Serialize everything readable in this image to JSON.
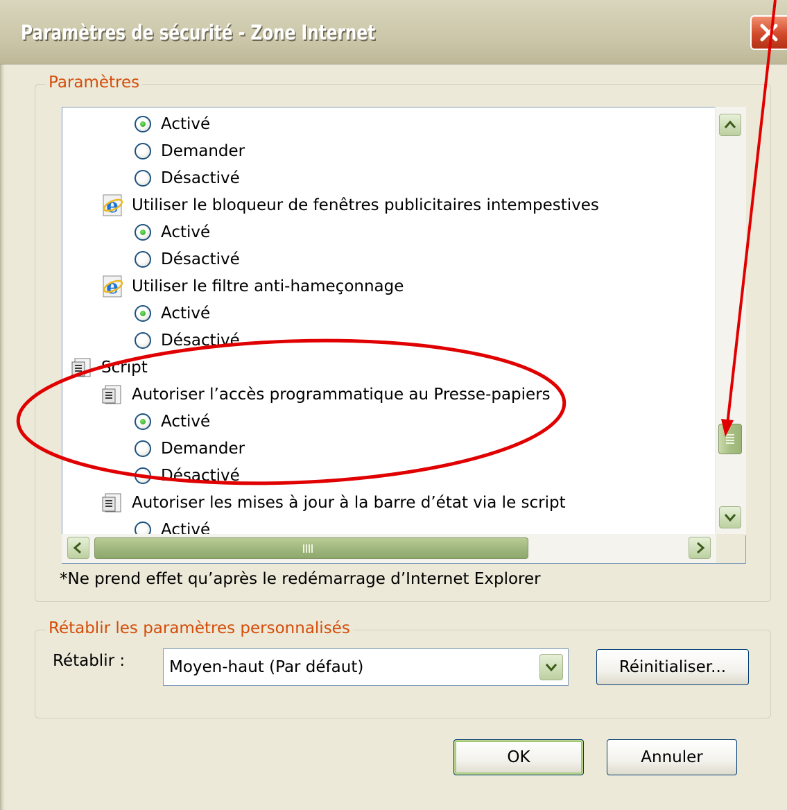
{
  "window": {
    "title": "Paramètres de sécurité - Zone Internet"
  },
  "settings_group": {
    "legend": "Paramètres",
    "items": [
      {
        "type": "option",
        "label": "Activé",
        "checked": true
      },
      {
        "type": "option",
        "label": "Demander",
        "checked": false
      },
      {
        "type": "option",
        "label": "Désactivé",
        "checked": false
      },
      {
        "type": "setting",
        "icon": "internet-explorer-icon",
        "label": "Utiliser le bloqueur de fenêtres publicitaires intempestives"
      },
      {
        "type": "option",
        "label": "Activé",
        "checked": true
      },
      {
        "type": "option",
        "label": "Désactivé",
        "checked": false
      },
      {
        "type": "setting",
        "icon": "internet-explorer-icon",
        "label": "Utiliser le filtre anti-hameçonnage"
      },
      {
        "type": "option",
        "label": "Activé",
        "checked": true
      },
      {
        "type": "option",
        "label": "Désactivé",
        "checked": false
      },
      {
        "type": "category",
        "icon": "script-icon",
        "label": "Script"
      },
      {
        "type": "setting",
        "icon": "script-icon",
        "label": "Autoriser l’accès programmatique au Presse-papiers"
      },
      {
        "type": "option",
        "label": "Activé",
        "checked": true
      },
      {
        "type": "option",
        "label": "Demander",
        "checked": false
      },
      {
        "type": "option",
        "label": "Désactivé",
        "checked": false
      },
      {
        "type": "setting",
        "icon": "script-icon",
        "label": "Autoriser les mises à jour à la barre d’état via le script"
      },
      {
        "type": "option",
        "label": "Activé",
        "checked": false
      }
    ],
    "note": "*Ne prend effet qu’après le redémarrage d’Internet Explorer"
  },
  "reset_group": {
    "legend": "Rétablir les paramètres personnalisés",
    "reset_label": "Rétablir :",
    "level_value": "Moyen-haut (Par défaut)",
    "reset_button": "Réinitialiser..."
  },
  "buttons": {
    "ok": "OK",
    "cancel": "Annuler"
  },
  "colors": {
    "annotation": "#e00000",
    "legend_text": "#d44d0a",
    "scrollbar": "#a8bf84"
  }
}
